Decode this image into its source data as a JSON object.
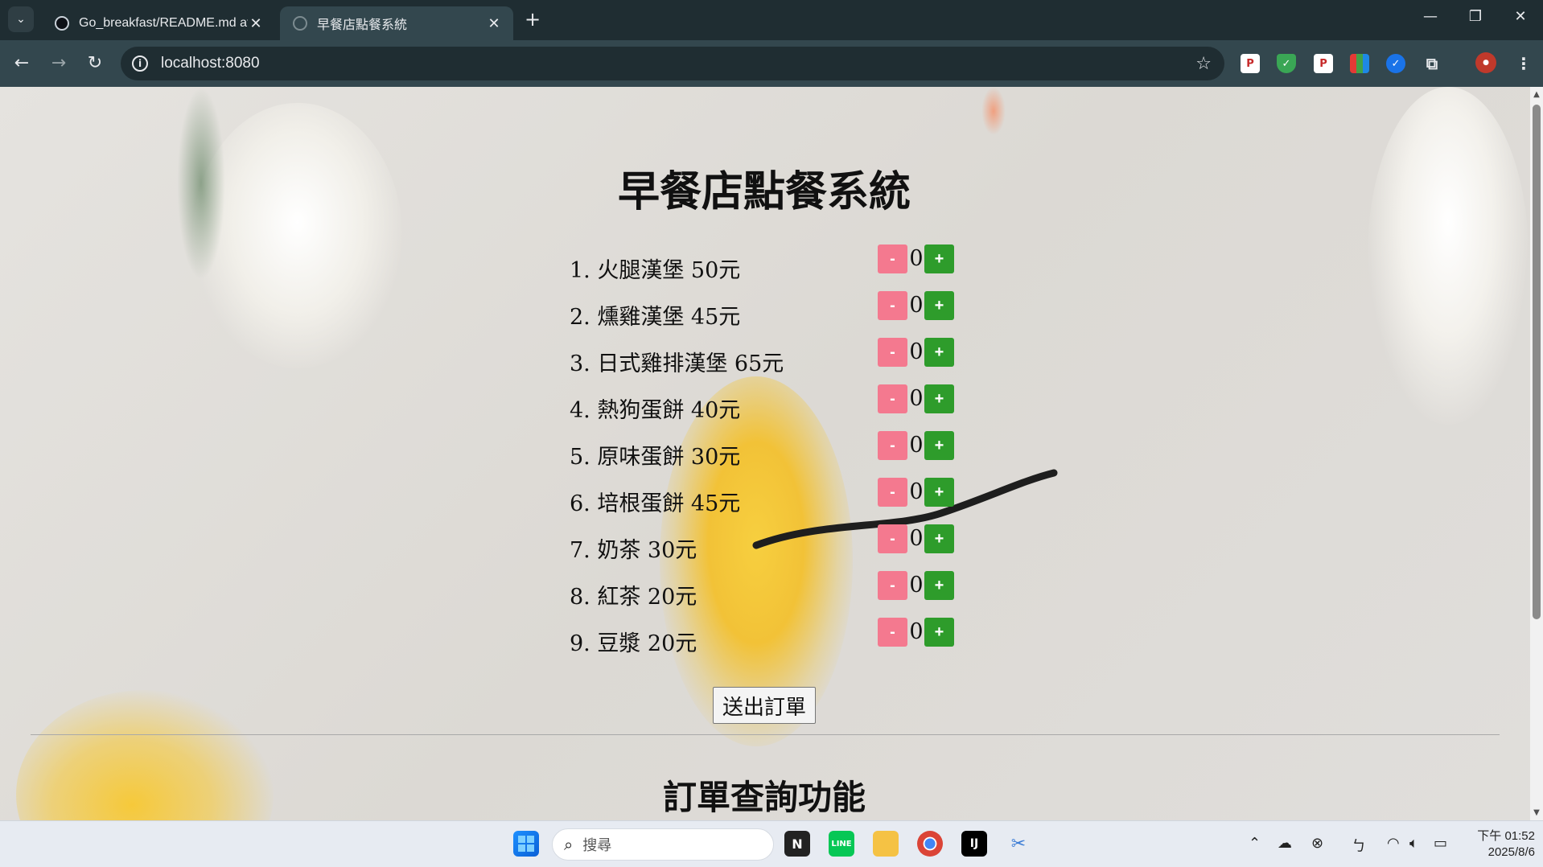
{
  "browser": {
    "tabs": [
      {
        "title": "Go_breakfast/README.md at",
        "active": false
      },
      {
        "title": "早餐店點餐系統",
        "active": true
      }
    ],
    "address": "localhost:8080"
  },
  "page": {
    "title": "早餐店點餐系統",
    "menu": [
      {
        "label": "1. 火腿漢堡 50元",
        "qty": "0"
      },
      {
        "label": "2. 燻雞漢堡 45元",
        "qty": "0"
      },
      {
        "label": "3. 日式雞排漢堡 65元",
        "qty": "0"
      },
      {
        "label": "4. 熱狗蛋餅 40元",
        "qty": "0"
      },
      {
        "label": "5. 原味蛋餅 30元",
        "qty": "0"
      },
      {
        "label": "6. 培根蛋餅 45元",
        "qty": "0"
      },
      {
        "label": "7. 奶茶 30元",
        "qty": "0"
      },
      {
        "label": "8. 紅茶 20元",
        "qty": "0"
      },
      {
        "label": "9. 豆漿 20元",
        "qty": "0"
      }
    ],
    "minus_label": "-",
    "plus_label": "+",
    "submit_label": "送出訂單",
    "query_title": "訂單查詢功能"
  },
  "taskbar": {
    "search_placeholder": "搜尋",
    "time": "下午 01:52",
    "date": "2025/8/6"
  },
  "colors": {
    "minus": "#f4798f",
    "plus": "#2e9c2b",
    "chrome_dark": "#1f2d32",
    "chrome_toolbar": "#33474e"
  },
  "icons": [
    "tab-search-icon",
    "github-icon",
    "globe-icon",
    "close-icon",
    "plus-icon",
    "minimize-icon",
    "restore-icon",
    "back-icon",
    "forward-icon",
    "reload-icon",
    "info-icon",
    "star-icon",
    "extensions-icon",
    "menu-icon",
    "windows-start-icon",
    "search-icon",
    "chrome-icon",
    "line-icon",
    "folder-icon",
    "wifi-icon",
    "volume-icon",
    "battery-icon"
  ]
}
